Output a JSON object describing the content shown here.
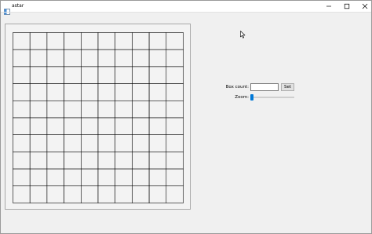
{
  "window": {
    "title": "astar"
  },
  "grid": {
    "rows": 10,
    "cols": 10,
    "line_color": "#000000",
    "background": "#f3f3f3"
  },
  "controls": {
    "box_count_label": "Box count:",
    "box_count_value": "",
    "set_button_label": "Set",
    "zoom_label": "Zoom:",
    "zoom_level": 0,
    "accent_color": "#0078d7"
  },
  "icons": {
    "app": "app-window-icon",
    "minimize": "minimize-icon",
    "maximize": "maximize-icon",
    "close": "close-icon",
    "cursor": "mouse-pointer-icon"
  }
}
